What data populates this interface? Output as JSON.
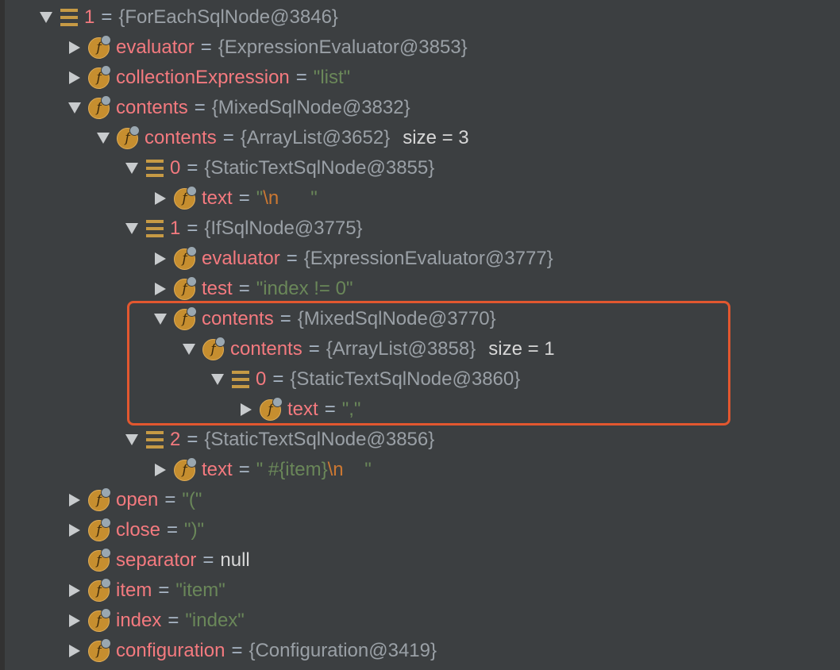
{
  "colors": {
    "background": "#3c3f41",
    "field_name": "#f47a7f",
    "object_ref": "#9aa0a6",
    "string_value": "#6a8759",
    "escape_char": "#cc7832",
    "highlight_box": "#e2572f",
    "field_icon": "#c68e2f",
    "array_icon": "#c69a45"
  },
  "tree": [
    {
      "depth": 0,
      "expanded": true,
      "icon": "array-icon",
      "name": "1",
      "value_type": "obj",
      "value": "{ForEachSqlNode@3846}"
    },
    {
      "depth": 1,
      "expanded": false,
      "icon": "field-icon",
      "name": "evaluator",
      "value_type": "obj",
      "value": "{ExpressionEvaluator@3853}"
    },
    {
      "depth": 1,
      "expanded": false,
      "icon": "field-icon",
      "name": "collectionExpression",
      "value_type": "str",
      "value": "\"list\""
    },
    {
      "depth": 1,
      "expanded": true,
      "icon": "field-icon",
      "name": "contents",
      "value_type": "obj",
      "value": "{MixedSqlNode@3832}"
    },
    {
      "depth": 2,
      "expanded": true,
      "icon": "field-icon",
      "name": "contents",
      "value_type": "obj",
      "value": "{ArrayList@3652}",
      "extra": "size = 3"
    },
    {
      "depth": 3,
      "expanded": true,
      "icon": "array-icon",
      "name": "0",
      "value_type": "obj",
      "value": "{StaticTextSqlNode@3855}"
    },
    {
      "depth": 4,
      "expanded": false,
      "icon": "field-icon",
      "name": "text",
      "value_type": "str_esc",
      "value": "\"",
      "esc": "\\n",
      "value_after": "      \""
    },
    {
      "depth": 3,
      "expanded": true,
      "icon": "array-icon",
      "name": "1",
      "value_type": "obj",
      "value": "{IfSqlNode@3775}"
    },
    {
      "depth": 4,
      "expanded": false,
      "icon": "field-icon",
      "name": "evaluator",
      "value_type": "obj",
      "value": "{ExpressionEvaluator@3777}"
    },
    {
      "depth": 4,
      "expanded": false,
      "icon": "field-icon",
      "name": "test",
      "value_type": "str",
      "value": "\"index != 0\""
    },
    {
      "depth": 4,
      "expanded": true,
      "icon": "field-icon",
      "name": "contents",
      "value_type": "obj",
      "value": "{MixedSqlNode@3770}"
    },
    {
      "depth": 5,
      "expanded": true,
      "icon": "field-icon",
      "name": "contents",
      "value_type": "obj",
      "value": "{ArrayList@3858}",
      "extra": "size = 1"
    },
    {
      "depth": 6,
      "expanded": true,
      "icon": "array-icon",
      "name": "0",
      "value_type": "obj",
      "value": "{StaticTextSqlNode@3860}"
    },
    {
      "depth": 7,
      "expanded": false,
      "icon": "field-icon",
      "name": "text",
      "value_type": "str",
      "value": "\",\""
    },
    {
      "depth": 3,
      "expanded": true,
      "icon": "array-icon",
      "name": "2",
      "value_type": "obj",
      "value": "{StaticTextSqlNode@3856}"
    },
    {
      "depth": 4,
      "expanded": false,
      "icon": "field-icon",
      "name": "text",
      "value_type": "str_esc",
      "value": "\" #{item}",
      "esc": "\\n",
      "value_after": "    \""
    },
    {
      "depth": 1,
      "expanded": false,
      "icon": "field-icon",
      "name": "open",
      "value_type": "str",
      "value": "\"(\""
    },
    {
      "depth": 1,
      "expanded": false,
      "icon": "field-icon",
      "name": "close",
      "value_type": "str",
      "value": "\")\""
    },
    {
      "depth": 1,
      "expanded": null,
      "icon": "field-icon",
      "name": "separator",
      "value_type": "plain",
      "value": "null"
    },
    {
      "depth": 1,
      "expanded": false,
      "icon": "field-icon",
      "name": "item",
      "value_type": "str",
      "value": "\"item\""
    },
    {
      "depth": 1,
      "expanded": false,
      "icon": "field-icon",
      "name": "index",
      "value_type": "str",
      "value": "\"index\""
    },
    {
      "depth": 1,
      "expanded": false,
      "icon": "field-icon",
      "name": "configuration",
      "value_type": "obj",
      "value": "{Configuration@3419}"
    }
  ],
  "equals_sign": "=",
  "f_glyph": "f"
}
